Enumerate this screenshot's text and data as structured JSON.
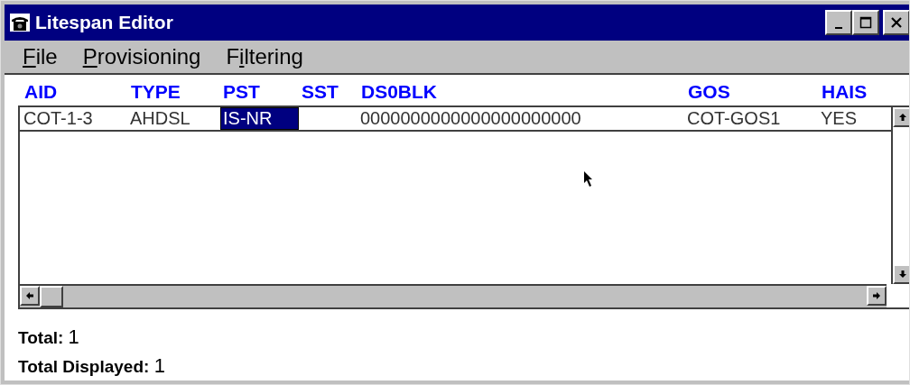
{
  "window": {
    "title": "Litespan Editor"
  },
  "menu": [
    {
      "key": "F",
      "after": "ile"
    },
    {
      "key": "P",
      "after": "rovisioning"
    },
    {
      "before": "F",
      "key": "i",
      "after": "ltering"
    }
  ],
  "table": {
    "columns": [
      "AID",
      "TYPE",
      "PST",
      "SST",
      "DS0BLK",
      "GOS",
      "HAIS"
    ],
    "rows": [
      {
        "cells": [
          {
            "text": "COT-1-3",
            "selected": false
          },
          {
            "text": "AHDSL",
            "selected": false
          },
          {
            "text": "IS-NR",
            "selected": true
          },
          {
            "selected": false
          },
          {
            "text": "0000000000000000000000",
            "selected": false
          },
          {
            "text": "COT-GOS1",
            "selected": false
          },
          {
            "text": "YES",
            "selected": false
          }
        ]
      }
    ]
  },
  "summary": [
    {
      "label": "Total:",
      "value": "1"
    },
    {
      "label": "Total Displayed:",
      "value": "1"
    }
  ]
}
